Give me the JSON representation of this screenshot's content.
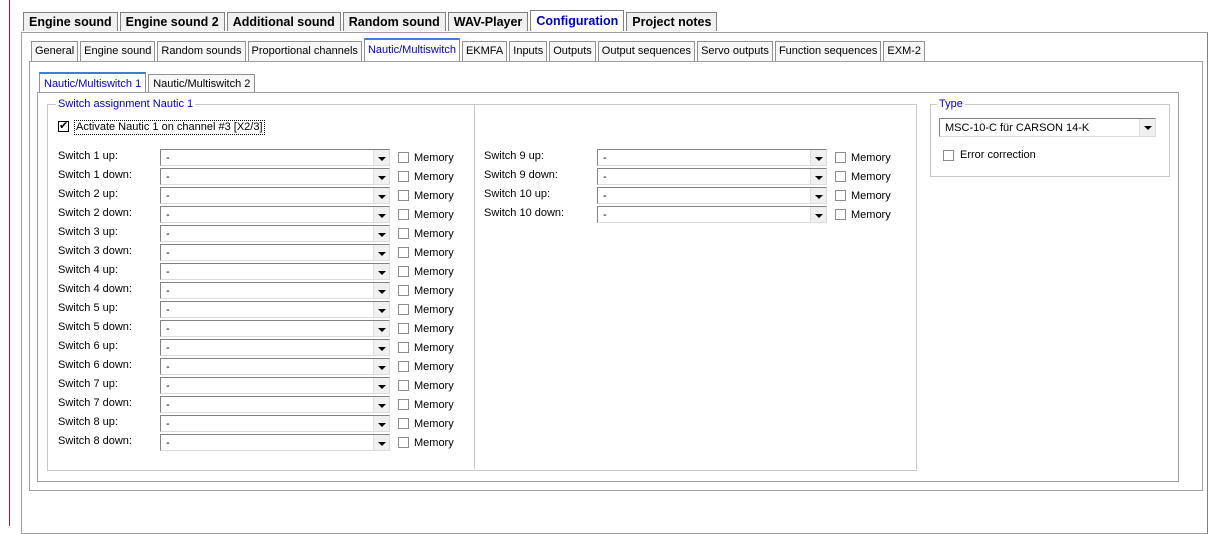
{
  "main_tabs": [
    "Engine sound",
    "Engine sound 2",
    "Additional sound",
    "Random sound",
    "WAV-Player",
    "Configuration",
    "Project notes"
  ],
  "main_active": 5,
  "sub_tabs": [
    "General",
    "Engine sound",
    "Random sounds",
    "Proportional channels",
    "Nautic/Multiswitch",
    "EKMFA",
    "Inputs",
    "Outputs",
    "Output sequences",
    "Servo outputs",
    "Function sequences",
    "EXM-2"
  ],
  "sub_active": 4,
  "inner_tabs": [
    "Nautic/Multiswitch 1",
    "Nautic/Multiswitch 2"
  ],
  "inner_active": 0,
  "switch_group": {
    "legend": "Switch assignment Nautic 1",
    "activate_label": "Activate Nautic 1 on channel #3 [X2/3]",
    "activate_checked": true,
    "memory_label": "Memory",
    "left_rows": [
      {
        "label": "Switch 1 up:",
        "value": "-"
      },
      {
        "label": "Switch 1 down:",
        "value": "-"
      },
      {
        "label": "Switch 2 up:",
        "value": "-"
      },
      {
        "label": "Switch 2 down:",
        "value": "-"
      },
      {
        "label": "Switch 3 up:",
        "value": "-"
      },
      {
        "label": "Switch 3 down:",
        "value": "-"
      },
      {
        "label": "Switch 4 up:",
        "value": "-"
      },
      {
        "label": "Switch 4 down:",
        "value": "-"
      },
      {
        "label": "Switch 5 up:",
        "value": "-"
      },
      {
        "label": "Switch 5 down:",
        "value": "-"
      },
      {
        "label": "Switch 6 up:",
        "value": "-"
      },
      {
        "label": "Switch 6 down:",
        "value": "-"
      },
      {
        "label": "Switch 7 up:",
        "value": "-"
      },
      {
        "label": "Switch 7 down:",
        "value": "-"
      },
      {
        "label": "Switch 8 up:",
        "value": "-"
      },
      {
        "label": "Switch 8 down:",
        "value": "-"
      }
    ],
    "right_rows": [
      {
        "label": "Switch 9 up:",
        "value": "-"
      },
      {
        "label": "Switch 9 down:",
        "value": "-"
      },
      {
        "label": "Switch 10 up:",
        "value": "-"
      },
      {
        "label": "Switch 10 down:",
        "value": "-"
      }
    ]
  },
  "type_group": {
    "legend": "Type",
    "selected": "MSC-10-C für CARSON 14-K",
    "error_correction_label": "Error correction",
    "error_correction_checked": false
  }
}
